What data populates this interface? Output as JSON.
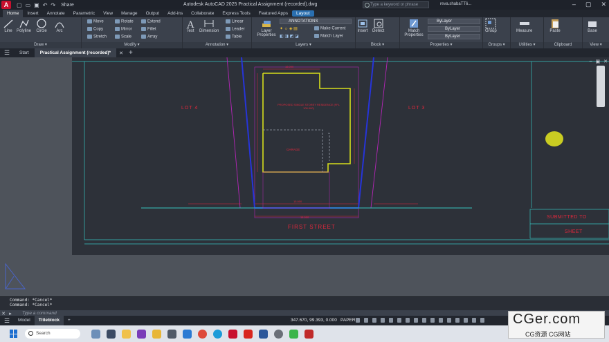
{
  "titlebar": {
    "logo": "A",
    "title": "Autodesk AutoCAD 2025    Practical Assignment (recorded).dwg",
    "share": "Share",
    "search_placeholder": "Type a keyword or phrase",
    "user": "reva.shabaTT6..."
  },
  "ribbon_tabs": [
    "Home",
    "Insert",
    "Annotate",
    "Parametric",
    "View",
    "Manage",
    "Output",
    "Add-ins",
    "Collaborate",
    "Express Tools",
    "Featured Apps",
    "Layout"
  ],
  "ribbon": {
    "draw": {
      "title": "Draw ▾",
      "tools": [
        "Line",
        "Polyline",
        "Circle",
        "Arc"
      ]
    },
    "modify": {
      "title": "Modify ▾",
      "rows": [
        [
          "Move",
          "Rotate",
          "Extend"
        ],
        [
          "Copy",
          "Mirror",
          "Fillet"
        ],
        [
          "Stretch",
          "Scale",
          "Array"
        ]
      ]
    },
    "annotation": {
      "title": "Annotation ▾",
      "text": "Text",
      "dimension": "Dimension",
      "rows": [
        "Linear",
        "Leader",
        "Table"
      ]
    },
    "layers": {
      "title": "Layers ▾",
      "props": "Layer Properties",
      "layer_name": "ANNOTATIONS",
      "make_current": "Make Current",
      "match_layer": "Match Layer"
    },
    "block": {
      "title": "Block ▾",
      "insert": "Insert",
      "detect": "Detect"
    },
    "properties": {
      "title": "Properties ▾",
      "match": "Match Properties",
      "bylayer": [
        "ByLayer",
        "ByLayer",
        "ByLayer"
      ]
    },
    "groups": {
      "title": "Groups ▾",
      "group": "Group"
    },
    "utilities": {
      "title": "Utilities ▾",
      "measure": "Measure"
    },
    "clipboard": {
      "title": "Clipboard",
      "paste": "Paste"
    },
    "view": {
      "title": "View ▾",
      "base": "Base"
    }
  },
  "doc_tabs": {
    "start": "Start",
    "active": "Practical Assignment (recorded)*",
    "add": "+"
  },
  "drawing": {
    "lot_left": "LOT 4",
    "lot_right": "LOT 3",
    "street": "FIRST STREET",
    "submitted": "SUBMITTED TO",
    "sheet": "SHEET",
    "house_note": "PROPOSED SINGLE STOREY RESIDENCE (FFL 100.000)",
    "garage": "GARAGE",
    "dim_top": "18.000",
    "dim_bottom": "15.000",
    "frontage": "15.000"
  },
  "command": {
    "history": [
      "Command: *Cancel*",
      "Command: *Cancel*"
    ],
    "placeholder": "Type a command"
  },
  "status": {
    "model": "Model",
    "titleblock": "Titleblock",
    "coords": "347.670, 99.393, 0.000",
    "paper": "PAPER"
  },
  "taskbar": {
    "search": "Search"
  },
  "watermark": {
    "big": "CGer.com",
    "small": "CG资源 CG网站"
  },
  "colors": {
    "outline": "#c8d11a",
    "lot": "#2634d9",
    "magenta": "#b525b8",
    "text_red": "#e0283c",
    "cyan": "#37c5c0"
  }
}
